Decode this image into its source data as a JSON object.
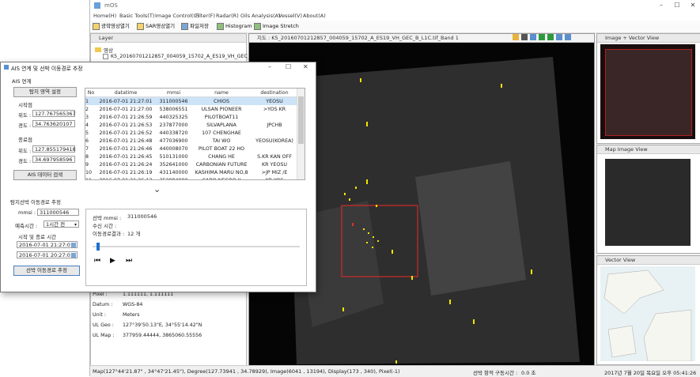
{
  "main": {
    "title": "mOS",
    "menus": [
      "Home(H)",
      "Basic Tools(T)",
      "Image Control(C)",
      "Filter(F)",
      "Radar(R)",
      "Oils Analysis(A)",
      "Vessel(V)",
      "About(A)"
    ],
    "toolbar": [
      "광학영상열기",
      "SAR영상열기",
      "파일저장",
      "Histogram",
      "Image Stretch"
    ]
  },
  "layer": {
    "title": "Layer",
    "folder": "영상",
    "file": "K5_20160701212857_004059_15702_A_ES19_VH_GEC_B"
  },
  "info": {
    "pixel_label": "Pixel :",
    "pixel_value": "1.111111, 1.111111",
    "datum_label": "Datum :",
    "datum_value": "WGS-84",
    "unit_label": "Unit :",
    "unit_value": "Meters",
    "ulgeo_label": "UL Geo :",
    "ulgeo_value": "127°39'50.13\"E, 34°55'14.42\"N",
    "ulmap_label": "UL Map :",
    "ulmap_value": "377959.44444, 3865060.55556"
  },
  "mapview": {
    "title": "지도 : K5_20160701212857_004059_15702_A_ES19_VH_GEC_B_L1C.tif_Band 1"
  },
  "panels": {
    "image_vector": "Image + Vector View",
    "map_image": "Map Image View",
    "vector": "Vector View"
  },
  "status": {
    "left": "Map(127°44'21.87\" , 34°47'21.45\"), Degree(127.73941 , 34.78929), Image(6041 , 13194), Display(173 , 340), Pixel(-1)",
    "right": "선박 항적 구동시간 :",
    "time_value": "0.0 초",
    "date": "2017년 7월 20일 목요일 오후 05:41:26"
  },
  "dialog": {
    "title": "AIS 연계 및 선박 이동경로 추정",
    "section1": "AIS 연계",
    "area_button": "탐지 영역 설정",
    "start_label": "시작점",
    "end_label": "종료점",
    "lat_label": "위도 :",
    "lon_label": "경도 :",
    "start_lat": "127.767565367",
    "start_lon": "34.763620107",
    "end_lat": "127.855179418",
    "end_lon": "34.697958596",
    "search_button": "AIS 데이터 검색",
    "section2": "탐지선박 이동경로 추정",
    "mmsi_label": "mmsi :",
    "mmsi_value": "311000546",
    "predict_label": "예측시간 :",
    "predict_value": "1시간 전",
    "range_label": "시작 및 종료 시간",
    "start_time": "2016-07-01 21:27:01",
    "end_time": "2016-07-01 20:27:01",
    "estimate_button": "선박 이동경로 추정",
    "columns": [
      "No",
      "datatime",
      "mmsi",
      "name",
      "destination"
    ],
    "rows": [
      [
        "1",
        "2016-07-01 21:27:01",
        "311000546",
        "CHIOS",
        "YEOSU"
      ],
      [
        "2",
        "2016-07-01 21:27:00",
        "538006551",
        "ULSAN PIONEER",
        ">YOS KR"
      ],
      [
        "3",
        "2016-07-01 21:26:59",
        "440325325",
        "PILOTBOAT11",
        ""
      ],
      [
        "4",
        "2016-07-01 21:26:53",
        "237877000",
        "SILVAPLANA",
        "JPCHB"
      ],
      [
        "5",
        "2016-07-01 21:26:52",
        "440338720",
        "107 CHENGHAE",
        ""
      ],
      [
        "6",
        "2016-07-01 21:26:48",
        "477036900",
        "TAI WO",
        "YEOSU(KOREA)"
      ],
      [
        "7",
        "2016-07-01 21:26:46",
        "440008070",
        "PILOT BOAT 22 HO",
        ""
      ],
      [
        "8",
        "2016-07-01 21:26:45",
        "510131000",
        "CHANG HE",
        "S.KR KAN OFF"
      ],
      [
        "9",
        "2016-07-01 21:26:24",
        "352641000",
        "CARBONIAN FUTURE",
        "KR YEOSU"
      ],
      [
        "10",
        "2016-07-01 21:26:19",
        "431140000",
        "KASHIMA MARU NO,8",
        ">JP MIZ /E"
      ],
      [
        "11",
        "2016-07-01 21:26:13",
        "352984000",
        "CABO NEGRO II",
        "KR YOS"
      ]
    ],
    "result_mmsi_label": "선박 mmsi :",
    "result_mmsi_value": "311000546",
    "recv_label": "수신 시간 :",
    "recv_value": "",
    "path_label": "이동경로결과 :",
    "path_value": "12 개",
    "playback_progress": 0.02
  }
}
